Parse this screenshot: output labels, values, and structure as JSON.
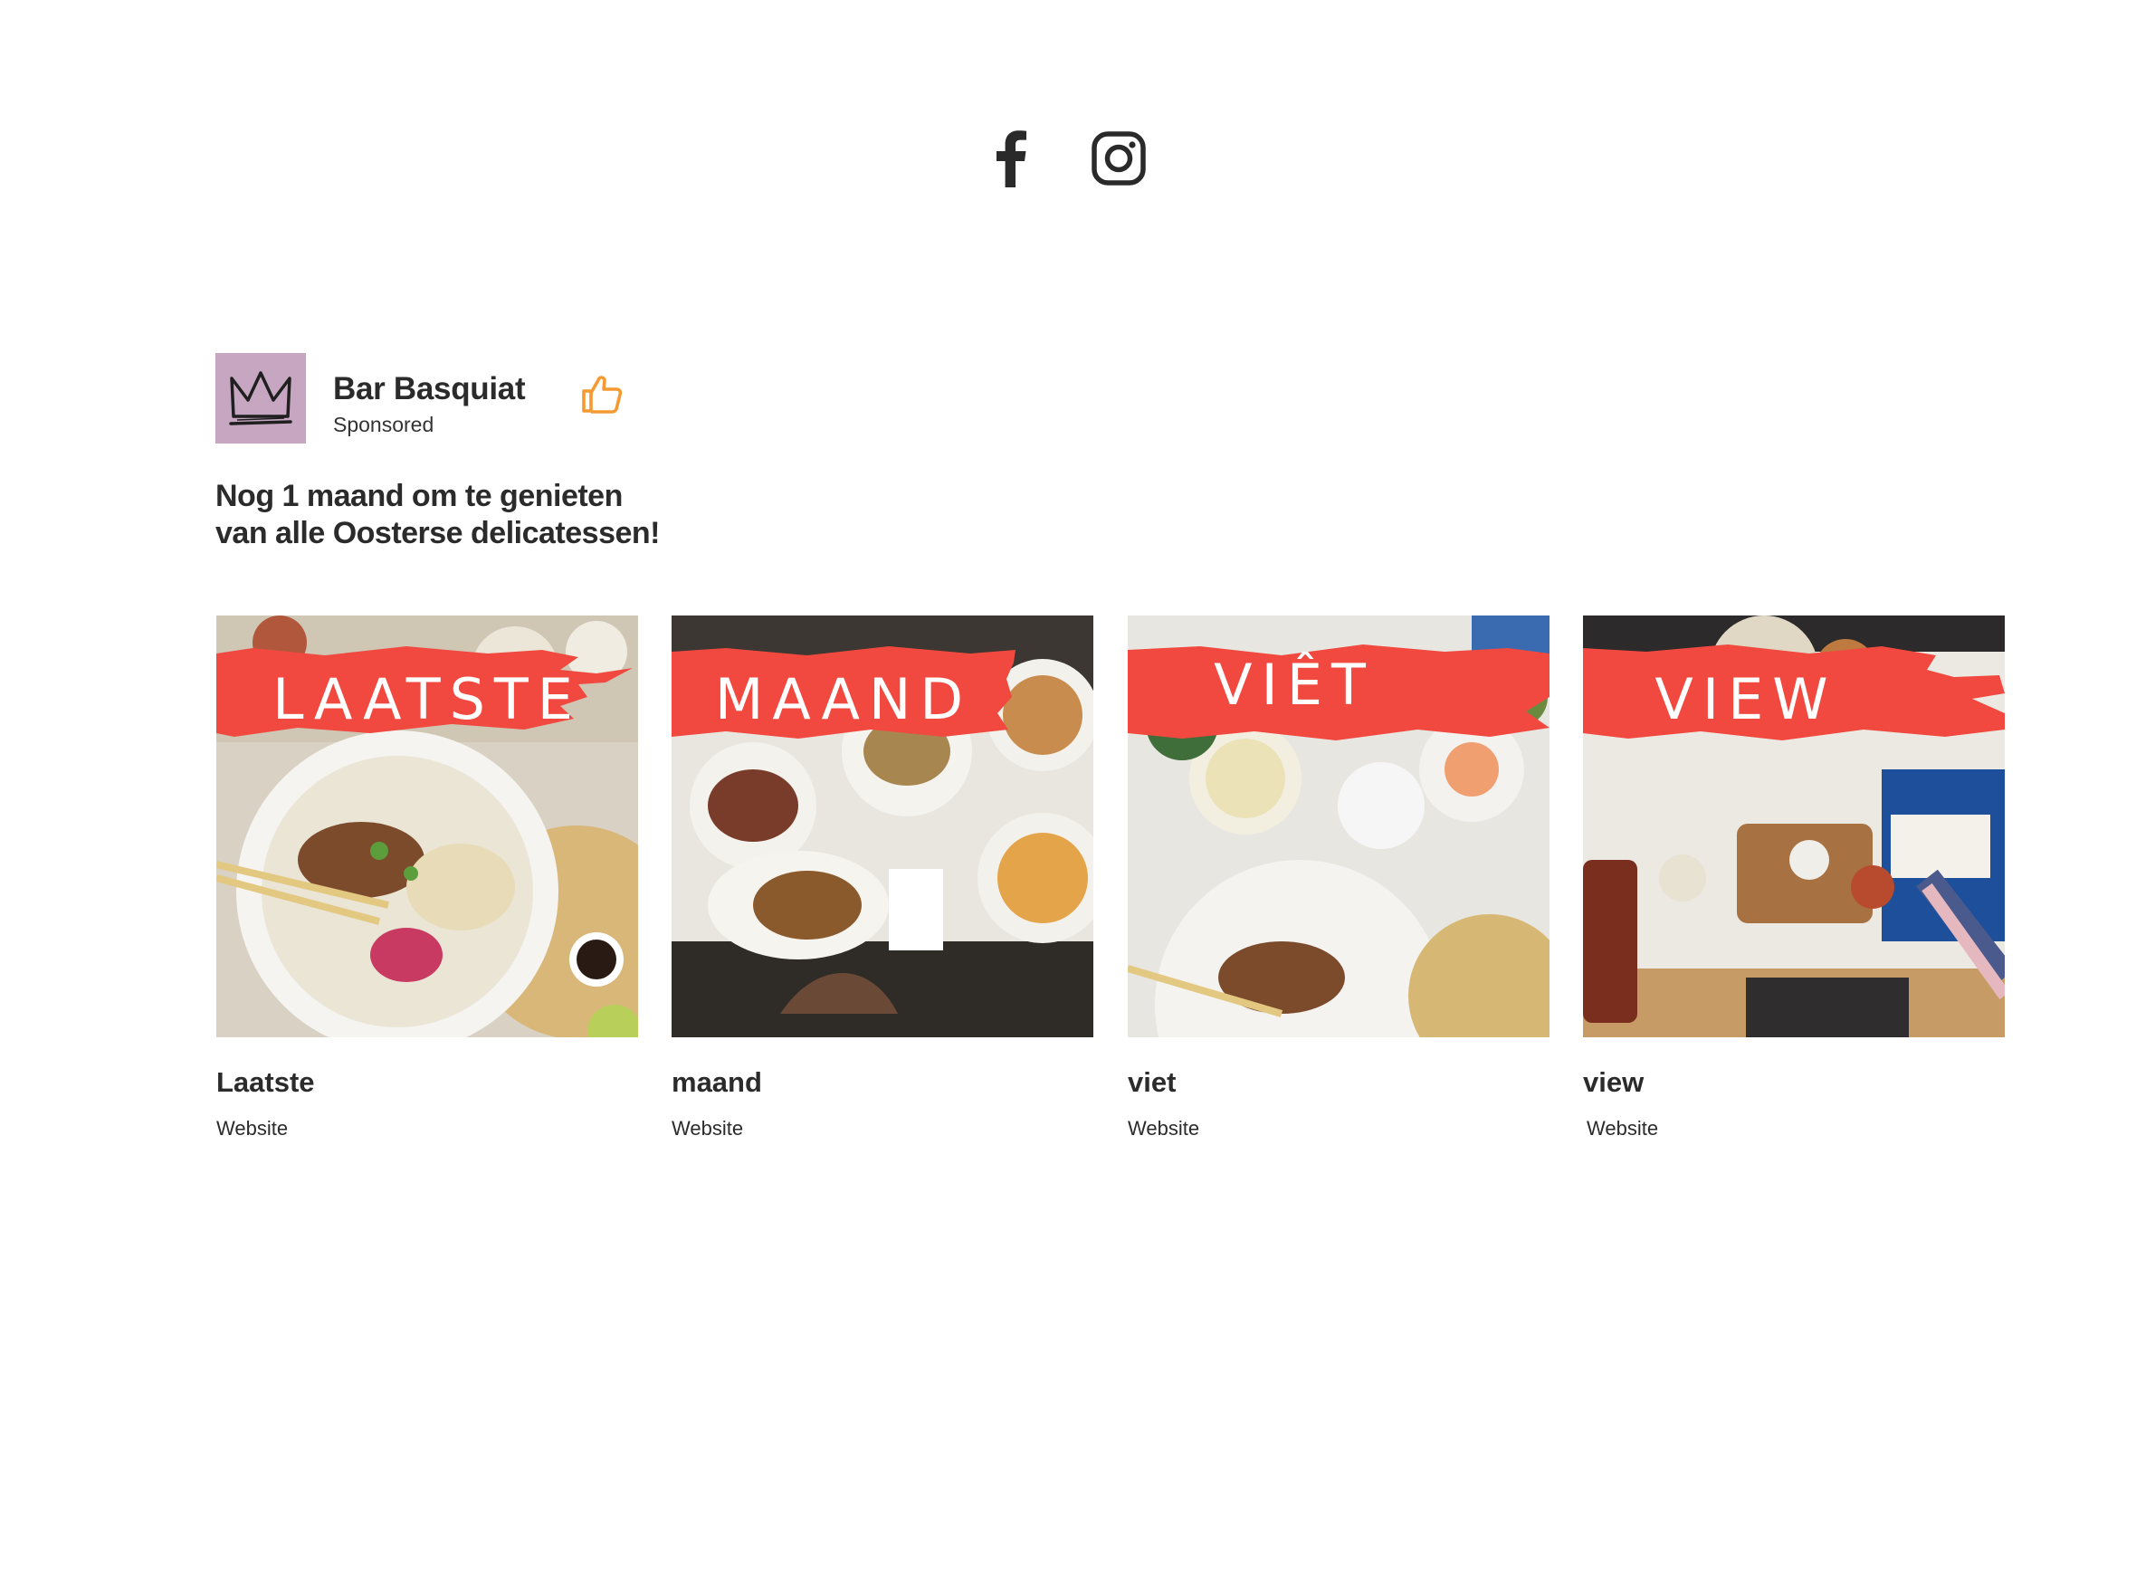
{
  "social": {
    "icons": [
      "facebook-icon",
      "instagram-icon"
    ]
  },
  "ad": {
    "brand_name": "Bar Basquiat",
    "sponsored_label": "Sponsored",
    "like_icon": "thumbs-up-icon",
    "text": "Nog 1 maand om te genieten van alle Oosterse delicatessen!",
    "accent_color": "#f59a32",
    "avatar_color": "#c9a8c3"
  },
  "carousel": {
    "brush_color": "#f1493f",
    "cards": [
      {
        "overlay": "LAATSTE",
        "title": "Laatste",
        "link": "Website"
      },
      {
        "overlay": "MAAND",
        "title": "maand",
        "link": "Website"
      },
      {
        "overlay": "VIÊT",
        "title": "viet",
        "link": "Website"
      },
      {
        "overlay": "VIEW",
        "title": "view",
        "link": "Website"
      }
    ]
  }
}
